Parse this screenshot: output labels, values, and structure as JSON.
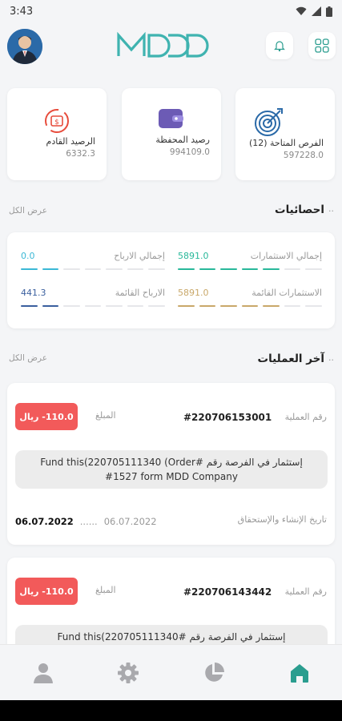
{
  "status": {
    "time": "3:43"
  },
  "summary": [
    {
      "label": "الرصيد القادم",
      "value": "6332.3",
      "icon": "money-cycle-icon"
    },
    {
      "label": "رصيد المحفظة",
      "value": "994109.0",
      "icon": "wallet-icon"
    },
    {
      "label": "الفرص المتاحة (12)",
      "value": "597228.0",
      "icon": "target-icon"
    }
  ],
  "stats": {
    "title": "احصائيات",
    "view_all": "عرض الكل",
    "items": [
      {
        "label": "إجمالي الارباح",
        "value": "0.0",
        "color": "#3bb8d6"
      },
      {
        "label": "إجمالي الاستثمارات",
        "value": "5891.0",
        "color": "#29b89a"
      },
      {
        "label": "الارباح القائمة",
        "value": "441.3",
        "color": "#3a5f9e"
      },
      {
        "label": "الاستثمارات القائمة",
        "value": "5891.0",
        "color": "#c9a86a"
      }
    ]
  },
  "transactions": {
    "title": "آخر العمليات",
    "view_all": "عرض الكل",
    "txno_label": "رقم العملية",
    "amount_label": "المبلغ",
    "dates_label": "تاريخ الإنشاء والإستحقاق",
    "items": [
      {
        "number": "#220706153001",
        "amount": "110.0- ريال",
        "desc": "إستثمار في الفرصة رقم  #Fund this(220705111340 (Order #1527 form MDD Company",
        "created": "06.07.2022",
        "due": "06.07.2022",
        "sep": "......"
      },
      {
        "number": "#220706143442",
        "amount": "110.0- ريال",
        "desc": "إستثمار في الفرصة رقم  #Fund this(220705111340",
        "created": "",
        "due": "",
        "sep": ""
      }
    ]
  },
  "colors": {
    "accent": "#2a9d8f",
    "logo": "#3fb3b0",
    "negative": "#f25a5a"
  }
}
